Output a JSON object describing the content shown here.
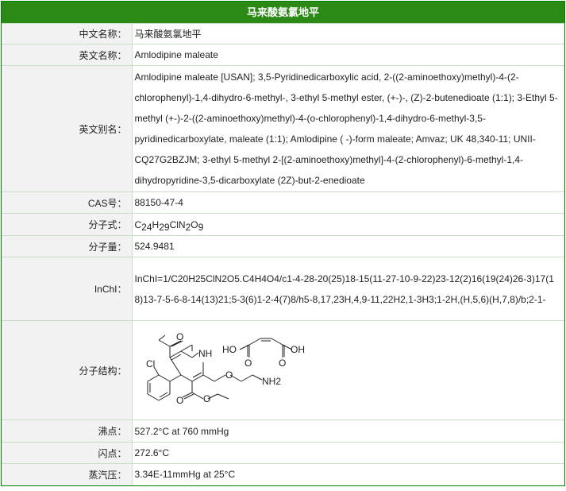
{
  "page": {
    "title": "马来酸氨氯地平"
  },
  "rows": {
    "cn_name": {
      "key": "中文名称：",
      "value": "马来酸氨氯地平"
    },
    "en_name": {
      "key": "英文名称：",
      "value": "Amlodipine maleate"
    },
    "en_alias": {
      "key": "英文别名：",
      "value": "Amlodipine maleate [USAN]; 3,5-Pyridinedicarboxylic acid, 2-((2-aminoethoxy)methyl)-4-(2-chlorophenyl)-1,4-dihydro-6-methyl-, 3-ethyl 5-methyl ester, (+-)-, (Z)-2-butenedioate (1:1); 3-Ethyl 5-methyl (+-)-2-((2-aminoethoxy)methyl)-4-(o-chlorophenyl)-1,4-dihydro-6-methyl-3,5-pyridinedicarboxylate, maleate (1:1); Amlodipine ( -)-form maleate; Amvaz; UK 48,340-11; UNII-CQ27G2BZJM; 3-ethyl 5-methyl 2-[(2-aminoethoxy)methyl]-4-(2-chlorophenyl)-6-methyl-1,4-dihydropyridine-3,5-dicarboxylate (2Z)-but-2-enedioate"
    },
    "cas": {
      "key": "CAS号：",
      "value": "88150-47-4"
    },
    "formula": {
      "key": "分子式：",
      "parts": [
        "C",
        "24",
        "H",
        "29",
        "ClN",
        "2",
        "O",
        "9"
      ]
    },
    "mw": {
      "key": "分子量：",
      "value": "524.9481"
    },
    "inchi": {
      "key": "InChI：",
      "value": "InChI=1/C20H25ClN2O5.C4H4O4/c1-4-28-20(25)18-15(11-27-10-9-22)23-12(2)16(19(24)26-3)17(18)13-7-5-6-8-14(13)21;5-3(6)1-2-4(7)8/h5-8,17,23H,4,9-11,22H2,1-3H3;1-2H,(H,5,6)(H,7,8)/b;2-1-"
    },
    "structure": {
      "key": "分子结构：",
      "atoms": {
        "nh": "NH",
        "cl": "Cl",
        "nh2": "NH2",
        "ho": "HO",
        "oh": "OH",
        "o": "O"
      }
    },
    "bp": {
      "key": "沸点：",
      "value": "527.2°C at 760 mmHg"
    },
    "fp": {
      "key": "闪点：",
      "value": "272.6°C"
    },
    "vp": {
      "key": "蒸汽压：",
      "value": "3.34E-11mmHg at 25°C"
    }
  }
}
